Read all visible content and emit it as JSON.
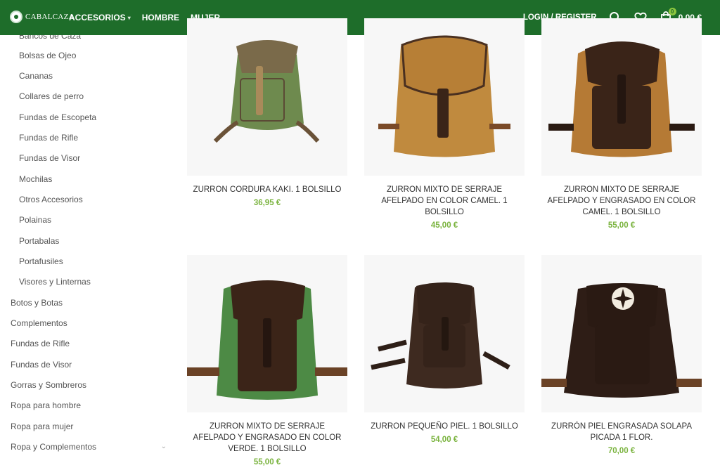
{
  "header": {
    "logo_text": "CABALCAZA",
    "nav": [
      {
        "label": "ACCESORIOS",
        "has_dropdown": true
      },
      {
        "label": "HOMBRE"
      },
      {
        "label": "MUJER"
      }
    ],
    "login_label": "LOGIN / REGISTER",
    "search_icon": "search-icon",
    "wishlist_icon": "heart-icon",
    "cart_icon": "shopping-bag-icon",
    "cart_count": "0",
    "cart_total": "0,00 €"
  },
  "sidebar": {
    "partial_first": "Bancos de Caza",
    "subcategories": [
      "Bolsas de Ojeo",
      "Cananas",
      "Collares de perro",
      "Fundas de Escopeta",
      "Fundas de Rifle",
      "Fundas de Visor",
      "Mochilas",
      "Otros Accesorios",
      "Polainas",
      "Portabalas",
      "Portafusiles",
      "Visores y Linternas"
    ],
    "categories": [
      "Botos y Botas",
      "Complementos",
      "Fundas de Rifle",
      "Fundas de Visor",
      "Gorras y Sombreros",
      "Ropa para hombre",
      "Ropa para mujer",
      "Ropa y Complementos"
    ]
  },
  "products": [
    {
      "name": "ZURRON CORDURA KAKI. 1 BOLSILLO",
      "price": "36,95 €",
      "body_color": "#6e8a4e",
      "flap_color": "#7a6a4a"
    },
    {
      "name": "ZURRON MIXTO DE SERRAJE AFELPADO EN COLOR CAMEL. 1 BOLSILLO",
      "price": "45,00 €",
      "body_color": "#c08a3e",
      "flap_color": "#b77f36"
    },
    {
      "name": "ZURRON MIXTO DE SERRAJE AFELPADO Y ENGRASADO EN COLOR CAMEL. 1 BOLSILLO",
      "price": "55,00 €",
      "body_color": "#b57a35",
      "flap_color": "#3a2418"
    },
    {
      "name": "ZURRON MIXTO DE SERRAJE AFELPADO Y ENGRASADO EN COLOR VERDE. 1 BOLSILLO",
      "price": "55,00 €",
      "body_color": "#4d8a45",
      "flap_color": "#3b2418"
    },
    {
      "name": "ZURRON PEQUEÑO PIEL. 1 BOLSILLO",
      "price": "54,00 €",
      "body_color": "#3e2a20",
      "flap_color": "#35231a"
    },
    {
      "name": "ZURRÓN PIEL ENGRASADA SOLAPA PICADA 1 FLOR.",
      "price": "70,00 €",
      "body_color": "#2e1d16",
      "flap_color": "#2a1a13"
    }
  ],
  "colors": {
    "header_bg": "#1e6d2a",
    "price": "#7ab33e",
    "badge": "#8dc63f"
  }
}
